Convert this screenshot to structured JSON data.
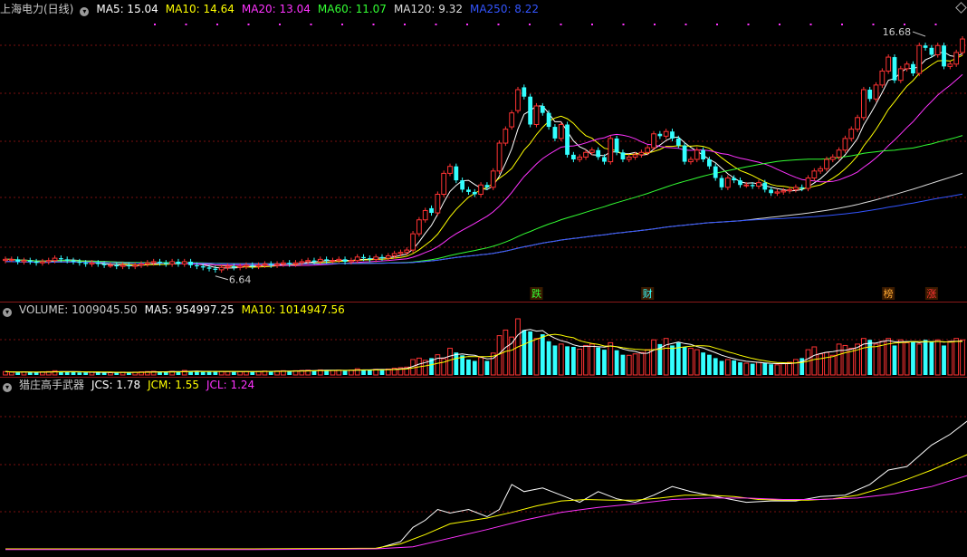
{
  "legend_main": {
    "title": "上海电力(日线)",
    "items": [
      {
        "text": "MA5: 15.04",
        "color": "#ffffff"
      },
      {
        "text": "MA10: 14.64",
        "color": "#ffff00"
      },
      {
        "text": "MA20: 13.04",
        "color": "#ff33ff"
      },
      {
        "text": "MA60: 11.07",
        "color": "#33ff33"
      },
      {
        "text": "MA120: 9.32",
        "color": "#dddddd"
      },
      {
        "text": "MA250: 8.22",
        "color": "#3355ff"
      }
    ]
  },
  "legend_volume": {
    "title": "VOLUME: 1009045.50",
    "items": [
      {
        "text": "MA5: 954997.25",
        "color": "#ffffff"
      },
      {
        "text": "MA10: 1014947.56",
        "color": "#ffff00"
      }
    ]
  },
  "legend_indicator": {
    "title": "猎庄高手武器",
    "items": [
      {
        "text": "JCS: 1.78",
        "color": "#ffffff"
      },
      {
        "text": "JCM: 1.55",
        "color": "#ffff00"
      },
      {
        "text": "JCL: 1.24",
        "color": "#ff33ff"
      }
    ]
  },
  "colors": {
    "up": "#ff3333",
    "down": "#33ffff",
    "grid": "#7a1010"
  },
  "chart_data": [
    {
      "type": "candlestick",
      "name": "price",
      "ylim": [
        5.5,
        17.5
      ],
      "annotations": [
        {
          "text": "16.68",
          "type": "high",
          "index": 149,
          "value": 16.68
        },
        {
          "text": "6.64",
          "type": "low",
          "index": 34,
          "value": 6.64
        }
      ],
      "event_tags": [
        {
          "text": "跌",
          "index": 86,
          "color": "#33ff33"
        },
        {
          "text": "财",
          "index": 104,
          "color": "#33ffff"
        },
        {
          "text": "榜",
          "index": 143,
          "color": "#ffaa33"
        },
        {
          "text": "涨",
          "index": 150,
          "color": "#ff3333"
        }
      ],
      "close": [
        7.2,
        7.2,
        7.1,
        7.15,
        7.1,
        7.05,
        7.1,
        7.15,
        7.25,
        7.2,
        7.15,
        7.1,
        7.05,
        7.0,
        7.05,
        7.0,
        6.95,
        6.95,
        6.9,
        6.95,
        6.9,
        6.95,
        7.0,
        7.05,
        7.1,
        7.05,
        7.0,
        7.1,
        7.0,
        7.1,
        6.95,
        6.9,
        6.85,
        6.8,
        6.75,
        6.85,
        6.9,
        6.85,
        6.9,
        6.95,
        6.9,
        6.95,
        7.0,
        6.95,
        7.0,
        7.05,
        7.0,
        7.05,
        7.1,
        7.15,
        7.1,
        7.2,
        7.15,
        7.15,
        7.2,
        7.1,
        7.15,
        7.3,
        7.25,
        7.2,
        7.3,
        7.25,
        7.35,
        7.45,
        7.5,
        7.6,
        8.3,
        8.9,
        9.3,
        9.2,
        10.0,
        10.9,
        11.2,
        10.6,
        10.2,
        10.1,
        10.0,
        10.4,
        10.3,
        11.0,
        12.2,
        12.8,
        13.5,
        14.5,
        14.2,
        13.0,
        13.8,
        13.5,
        12.9,
        12.4,
        13.0,
        11.7,
        11.5,
        11.6,
        11.8,
        11.9,
        11.6,
        11.4,
        12.4,
        11.8,
        11.5,
        11.6,
        11.7,
        11.8,
        12.0,
        12.6,
        12.5,
        12.7,
        12.4,
        12.1,
        11.4,
        11.5,
        11.9,
        11.5,
        11.2,
        10.7,
        10.3,
        10.7,
        10.6,
        10.4,
        10.4,
        10.35,
        10.5,
        10.2,
        10.05,
        10.1,
        10.15,
        10.2,
        10.3,
        10.25,
        10.7,
        11.0,
        11.1,
        11.5,
        11.6,
        11.9,
        12.4,
        12.8,
        13.3,
        14.5,
        14.1,
        14.7,
        15.3,
        15.9,
        14.9,
        15.4,
        15.6,
        15.2,
        16.4,
        16.3,
        16.0,
        16.4,
        15.5,
        15.6,
        16.1,
        16.68
      ],
      "open": [
        7.15,
        7.2,
        7.2,
        7.1,
        7.15,
        7.1,
        7.05,
        7.1,
        7.15,
        7.25,
        7.2,
        7.15,
        7.1,
        7.05,
        7.0,
        7.05,
        7.0,
        6.95,
        6.95,
        6.9,
        6.95,
        6.9,
        6.95,
        7.0,
        7.05,
        7.1,
        7.05,
        7.0,
        7.1,
        7.0,
        7.1,
        6.95,
        6.9,
        6.85,
        6.8,
        6.75,
        6.85,
        6.9,
        6.85,
        6.9,
        6.95,
        6.9,
        6.95,
        7.0,
        6.95,
        7.0,
        7.05,
        7.0,
        7.05,
        7.1,
        7.15,
        7.1,
        7.2,
        7.15,
        7.15,
        7.2,
        7.1,
        7.15,
        7.3,
        7.25,
        7.2,
        7.3,
        7.25,
        7.35,
        7.45,
        7.5,
        7.6,
        8.3,
        8.9,
        9.4,
        9.2,
        10.0,
        10.9,
        11.2,
        10.6,
        10.2,
        10.1,
        10.0,
        10.4,
        10.3,
        11.0,
        12.2,
        12.9,
        13.6,
        14.6,
        14.2,
        13.0,
        13.8,
        13.5,
        12.9,
        12.4,
        13.0,
        11.7,
        11.5,
        11.6,
        11.8,
        11.9,
        11.6,
        11.4,
        12.4,
        11.8,
        11.5,
        11.6,
        11.7,
        11.8,
        12.0,
        12.6,
        12.5,
        12.7,
        12.4,
        12.1,
        11.4,
        11.5,
        11.9,
        11.5,
        11.2,
        10.7,
        10.3,
        10.7,
        10.6,
        10.4,
        10.4,
        10.35,
        10.5,
        10.2,
        10.05,
        10.1,
        10.15,
        10.2,
        10.3,
        10.25,
        10.7,
        11.0,
        11.1,
        11.5,
        11.6,
        11.9,
        12.4,
        12.8,
        13.3,
        14.5,
        14.1,
        14.7,
        15.3,
        15.9,
        14.9,
        15.4,
        15.6,
        15.2,
        16.4,
        16.3,
        16.0,
        16.4,
        15.5,
        15.6,
        16.1
      ]
    },
    {
      "type": "bar",
      "name": "volume",
      "values": [
        0.12,
        0.1,
        0.09,
        0.11,
        0.1,
        0.09,
        0.11,
        0.12,
        0.15,
        0.13,
        0.11,
        0.1,
        0.09,
        0.09,
        0.1,
        0.09,
        0.09,
        0.08,
        0.09,
        0.1,
        0.09,
        0.1,
        0.11,
        0.12,
        0.13,
        0.11,
        0.1,
        0.13,
        0.12,
        0.16,
        0.14,
        0.12,
        0.11,
        0.12,
        0.14,
        0.13,
        0.12,
        0.11,
        0.12,
        0.13,
        0.12,
        0.13,
        0.14,
        0.13,
        0.14,
        0.15,
        0.14,
        0.15,
        0.16,
        0.17,
        0.16,
        0.18,
        0.17,
        0.16,
        0.17,
        0.15,
        0.17,
        0.22,
        0.19,
        0.18,
        0.2,
        0.19,
        0.21,
        0.24,
        0.26,
        0.28,
        0.55,
        0.6,
        0.52,
        0.6,
        0.72,
        0.58,
        0.95,
        0.8,
        0.7,
        0.55,
        0.5,
        0.62,
        0.5,
        0.78,
        1.4,
        1.6,
        1.35,
        2.0,
        1.6,
        1.55,
        1.3,
        1.45,
        1.2,
        1.05,
        1.1,
        1.02,
        1.0,
        0.92,
        1.05,
        1.1,
        0.98,
        0.9,
        1.15,
        0.88,
        0.72,
        0.7,
        0.75,
        0.8,
        0.9,
        1.25,
        1.1,
        1.3,
        1.05,
        1.15,
        1.0,
        0.95,
        0.9,
        0.8,
        0.72,
        0.6,
        0.5,
        0.55,
        0.52,
        0.45,
        0.42,
        0.4,
        0.45,
        0.42,
        0.38,
        0.36,
        0.4,
        0.45,
        0.55,
        0.6,
        0.9,
        1.0,
        0.75,
        0.8,
        0.7,
        1.1,
        1.05,
        0.95,
        1.1,
        1.3,
        1.25,
        1.1,
        1.2,
        1.3,
        1.05,
        1.25,
        1.15,
        1.2,
        1.1,
        1.25,
        1.2,
        1.25,
        1.05,
        1.2,
        1.3,
        1.25
      ]
    },
    {
      "type": "line",
      "name": "indicator",
      "ylim": [
        0,
        2.2
      ],
      "series": [
        {
          "name": "JCS",
          "color": "#ffffff",
          "points": [
            [
              0,
              0.05
            ],
            [
              40,
              0.05
            ],
            [
              60,
              0.05
            ],
            [
              64,
              0.15
            ],
            [
              66,
              0.35
            ],
            [
              68,
              0.45
            ],
            [
              70,
              0.6
            ],
            [
              72,
              0.55
            ],
            [
              75,
              0.6
            ],
            [
              78,
              0.5
            ],
            [
              80,
              0.6
            ],
            [
              82,
              0.95
            ],
            [
              84,
              0.85
            ],
            [
              87,
              0.9
            ],
            [
              90,
              0.8
            ],
            [
              93,
              0.7
            ],
            [
              96,
              0.85
            ],
            [
              99,
              0.75
            ],
            [
              102,
              0.7
            ],
            [
              105,
              0.8
            ],
            [
              108,
              0.92
            ],
            [
              111,
              0.85
            ],
            [
              114,
              0.8
            ],
            [
              117,
              0.75
            ],
            [
              120,
              0.7
            ],
            [
              124,
              0.72
            ],
            [
              128,
              0.72
            ],
            [
              132,
              0.78
            ],
            [
              136,
              0.8
            ],
            [
              140,
              0.95
            ],
            [
              143,
              1.15
            ],
            [
              146,
              1.2
            ],
            [
              148,
              1.35
            ],
            [
              150,
              1.5
            ],
            [
              153,
              1.65
            ],
            [
              156,
              1.85
            ],
            [
              158,
              1.85
            ],
            [
              160,
              1.78
            ]
          ]
        },
        {
          "name": "JCM",
          "color": "#ffff00",
          "points": [
            [
              0,
              0.05
            ],
            [
              40,
              0.05
            ],
            [
              60,
              0.06
            ],
            [
              64,
              0.12
            ],
            [
              68,
              0.25
            ],
            [
              72,
              0.4
            ],
            [
              78,
              0.48
            ],
            [
              82,
              0.56
            ],
            [
              86,
              0.65
            ],
            [
              90,
              0.72
            ],
            [
              94,
              0.74
            ],
            [
              98,
              0.73
            ],
            [
              102,
              0.73
            ],
            [
              106,
              0.76
            ],
            [
              110,
              0.8
            ],
            [
              114,
              0.8
            ],
            [
              118,
              0.78
            ],
            [
              122,
              0.74
            ],
            [
              126,
              0.73
            ],
            [
              130,
              0.73
            ],
            [
              134,
              0.75
            ],
            [
              138,
              0.8
            ],
            [
              142,
              0.9
            ],
            [
              146,
              1.02
            ],
            [
              150,
              1.15
            ],
            [
              154,
              1.3
            ],
            [
              158,
              1.45
            ],
            [
              160,
              1.55
            ]
          ]
        },
        {
          "name": "JCL",
          "color": "#ff33ff",
          "points": [
            [
              0,
              0.04
            ],
            [
              40,
              0.04
            ],
            [
              60,
              0.05
            ],
            [
              66,
              0.08
            ],
            [
              72,
              0.2
            ],
            [
              78,
              0.32
            ],
            [
              84,
              0.45
            ],
            [
              90,
              0.56
            ],
            [
              96,
              0.63
            ],
            [
              102,
              0.68
            ],
            [
              108,
              0.74
            ],
            [
              114,
              0.76
            ],
            [
              120,
              0.76
            ],
            [
              126,
              0.74
            ],
            [
              132,
              0.74
            ],
            [
              138,
              0.76
            ],
            [
              144,
              0.82
            ],
            [
              150,
              0.92
            ],
            [
              156,
              1.08
            ],
            [
              160,
              1.24
            ]
          ]
        }
      ]
    }
  ]
}
